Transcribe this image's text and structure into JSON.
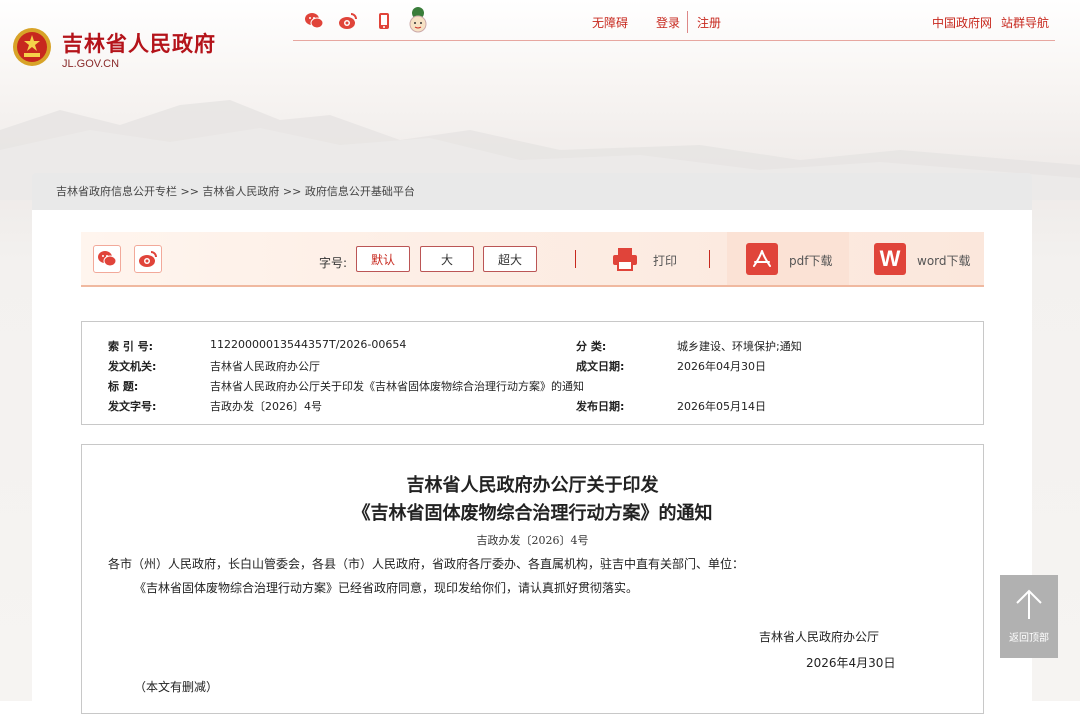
{
  "header": {
    "title": "吉林省人民政府",
    "domain": "JL.GOV.CN",
    "accessibility": "无障碍",
    "login": "登录",
    "register": "注册",
    "gov_cn": "中国政府网",
    "site_nav": "站群导航"
  },
  "breadcrumb": "吉林省政府信息公开专栏 >> 吉林省人民政府 >> 政府信息公开基础平台",
  "toolbar": {
    "font_label": "字号:",
    "font_default": "默认",
    "font_large": "大",
    "font_xlarge": "超大",
    "print": "打印",
    "pdf": "pdf下载",
    "word": "word下载",
    "word_glyph": "W"
  },
  "meta": {
    "index_label": "索 引 号:",
    "index_value": "11220000013544357T/2026-00654",
    "category_label": "分 类:",
    "category_value": "城乡建设、环境保护;通知",
    "issuer_label": "发文机关:",
    "issuer_value": "吉林省人民政府办公厅",
    "written_label": "成文日期:",
    "written_value": "2026年04月30日",
    "title_label": "标 题:",
    "title_value": "吉林省人民政府办公厅关于印发《吉林省固体废物综合治理行动方案》的通知",
    "docno_label": "发文字号:",
    "docno_value": "吉政办发〔2026〕4号",
    "published_label": "发布日期:",
    "published_value": "2026年05月14日"
  },
  "document": {
    "title_line1": "吉林省人民政府办公厅关于印发",
    "title_line2": "《吉林省固体废物综合治理行动方案》的通知",
    "doc_number": "吉政办发〔2026〕4号",
    "salutation": "各市（州）人民政府，长白山管委会，各县（市）人民政府，省政府各厅委办、各直属机构，驻吉中直有关部门、单位：",
    "body": "《吉林省固体废物综合治理行动方案》已经省政府同意，现印发给你们，请认真抓好贯彻落实。",
    "signature": "吉林省人民政府办公厅",
    "date": "2026年4月30日",
    "note": "（本文有删减）"
  },
  "back_to_top": "返回顶部",
  "colors": {
    "brand_red": "#c7281e",
    "title_red": "#b4131a",
    "toolbar_bg": "#fdeee5",
    "back_top_gray": "#b1b1b1"
  },
  "icons": [
    "emblem-icon",
    "wechat-icon",
    "weibo-icon",
    "mobile-icon",
    "mascot-icon",
    "printer-icon",
    "pdf-icon",
    "word-icon",
    "arrow-up-icon"
  ]
}
